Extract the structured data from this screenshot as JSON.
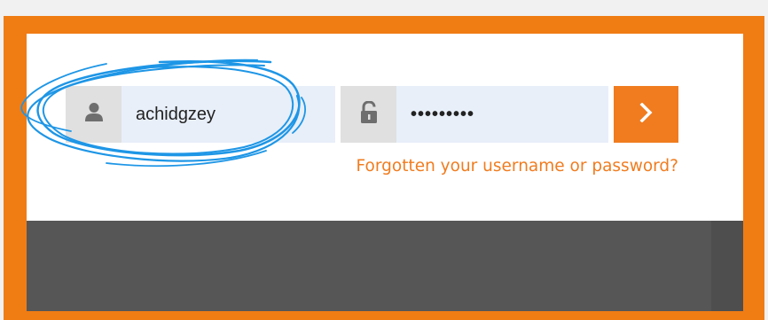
{
  "login": {
    "username_value": "achidgzey",
    "password_value": "•••••••••",
    "submit_icon": "chevron-right-icon",
    "forgot_link": "Forgotten your username or password?"
  },
  "icons": {
    "user": "user-icon",
    "lock": "unlock-icon"
  },
  "colors": {
    "accent": "#f07c1f",
    "frame": "#f07c14",
    "field_bg": "#e8eff9",
    "icon_bg": "#e0e0e0",
    "footer": "#565656",
    "annotation": "#1e96e6"
  }
}
